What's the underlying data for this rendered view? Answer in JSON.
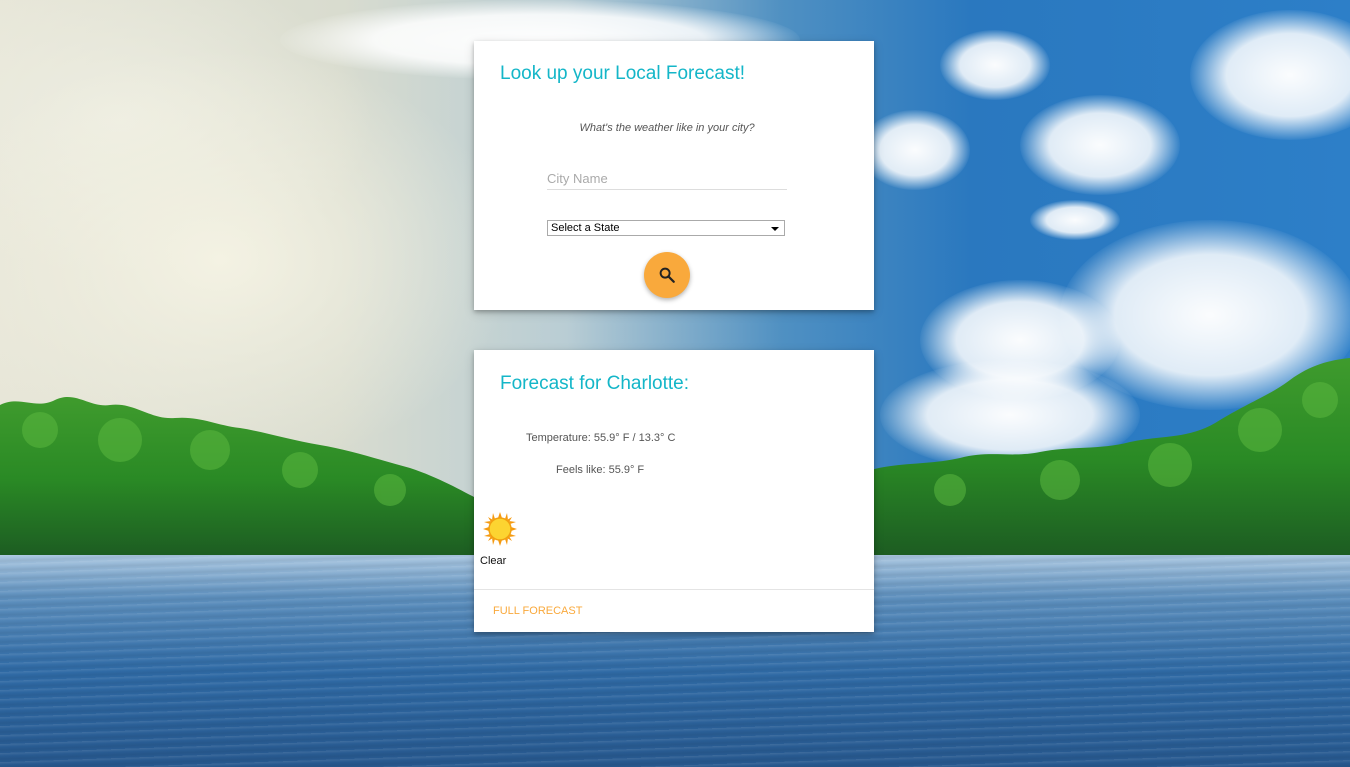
{
  "search_card": {
    "title": "Look up your Local Forecast!",
    "subtitle": "What's the weather like in your city?",
    "city_placeholder": "City Name",
    "city_value": "",
    "state_selected": "Select a State",
    "search_icon": "search-icon"
  },
  "forecast_card": {
    "title": "Forecast for Charlotte:",
    "temperature": "Temperature: 55.9° F / 13.3° C",
    "feels_like": "Feels like: 55.9° F",
    "condition_icon": "sun-icon",
    "condition": "Clear",
    "link_label": "FULL FORECAST"
  },
  "colors": {
    "title": "#14b6c8",
    "accent": "#f9a93c"
  }
}
